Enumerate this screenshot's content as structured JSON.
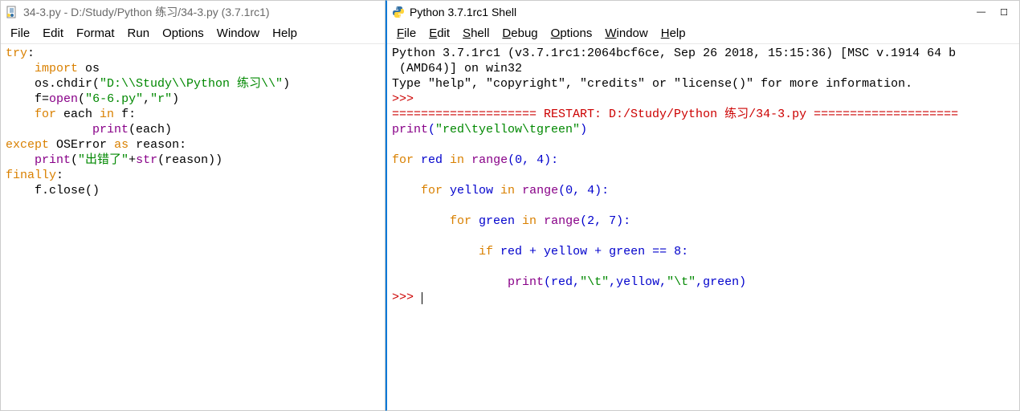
{
  "left_window": {
    "title": "34-3.py - D:/Study/Python 练习/34-3.py (3.7.1rc1)",
    "menu": [
      "File",
      "Edit",
      "Format",
      "Run",
      "Options",
      "Window",
      "Help"
    ],
    "menu_ul": [
      "F",
      "E",
      "o",
      "R",
      "O",
      "W",
      "H"
    ],
    "code": {
      "l1_try": "try",
      "l1_colon": ":",
      "l2_indent": "    ",
      "l2_import": "import",
      "l2_os": " os",
      "l3_indent": "    ",
      "l3_os_chdir": "os.chdir(",
      "l3_str": "\"D:\\\\Study\\\\Python 练习\\\\\"",
      "l3_close": ")",
      "l4_indent": "    ",
      "l4_f": "f=",
      "l4_open": "open",
      "l4_paren": "(",
      "l4_str1": "\"6-6.py\"",
      "l4_comma": ",",
      "l4_str2": "\"r\"",
      "l4_close": ")",
      "l5_indent": "    ",
      "l5_for": "for",
      "l5_each": " each ",
      "l5_in": "in",
      "l5_f": " f:",
      "l6_indent": "            ",
      "l6_print": "print",
      "l6_arg": "(each)",
      "l7_except": "except",
      "l7_sp": " ",
      "l7_oserror": "OSError",
      "l7_sp2": " ",
      "l7_as": "as",
      "l7_reason": " reason:",
      "l8_indent": "    ",
      "l8_print": "print",
      "l8_paren": "(",
      "l8_str": "\"出错了\"",
      "l8_plus": "+",
      "l8_strf": "str",
      "l8_arg": "(reason))",
      "l9_finally": "finally",
      "l9_colon": ":",
      "l10_indent": "    ",
      "l10_close": "f.close()"
    }
  },
  "right_window": {
    "title": "Python 3.7.1rc1 Shell",
    "menu": [
      "File",
      "Edit",
      "Shell",
      "Debug",
      "Options",
      "Window",
      "Help"
    ],
    "menu_ul": [
      "F",
      "E",
      "S",
      "D",
      "O",
      "W",
      "H"
    ],
    "shell": {
      "banner1": "Python 3.7.1rc1 (v3.7.1rc1:2064bcf6ce, Sep 26 2018, 15:15:36) [MSC v.1914 64 b",
      "banner2": " (AMD64)] on win32",
      "banner3": "Type \"help\", \"copyright\", \"credits\" or \"license()\" for more information.",
      "prompt1": ">>> ",
      "restart": "==================== RESTART: D:/Study/Python 练习/34-3.py ====================",
      "line1_print": "print",
      "line1_paren": "(",
      "line1_str": "\"red\\tyellow\\tgreen\"",
      "line1_close": ")",
      "blank": "",
      "line2_for": "for",
      "line2_rest": " red ",
      "line2_in": "in",
      "line2_sp": " ",
      "line2_range": "range",
      "line2_args": "(0, 4):",
      "line3_indent": "    ",
      "line3_for": "for",
      "line3_rest": " yellow ",
      "line3_in": "in",
      "line3_sp": " ",
      "line3_range": "range",
      "line3_args": "(0, 4):",
      "line4_indent": "        ",
      "line4_for": "for",
      "line4_rest": " green ",
      "line4_in": "in",
      "line4_sp": " ",
      "line4_range": "range",
      "line4_args": "(2, 7):",
      "line5_indent": "            ",
      "line5_if": "if",
      "line5_rest": " red + yellow + green == 8:",
      "line6_indent": "                ",
      "line6_print": "print",
      "line6_paren": "(red,",
      "line6_str1": "\"\\t\"",
      "line6_mid": ",yellow,",
      "line6_str2": "\"\\t\"",
      "line6_end": ",green)",
      "prompt2": ">>> "
    }
  }
}
